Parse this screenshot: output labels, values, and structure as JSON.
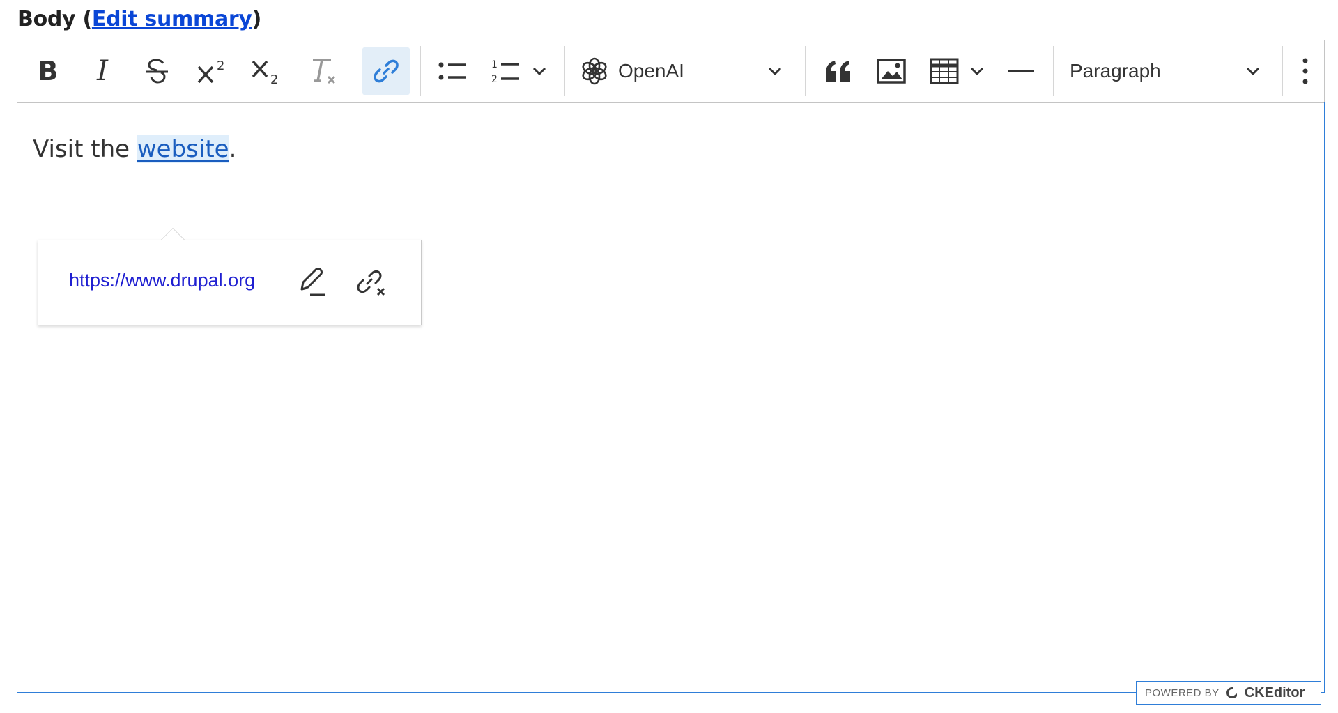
{
  "field": {
    "label_prefix": "Body (",
    "edit_summary_link": "Edit summary",
    "label_suffix": ")"
  },
  "toolbar": {
    "bold_label": "B",
    "italic_label": "I",
    "openai_label": "OpenAI",
    "paragraph_label": "Paragraph"
  },
  "content": {
    "text_before": "Visit the ",
    "link_text": "website",
    "text_after": "."
  },
  "link_balloon": {
    "url": "https://www.drupal.org"
  },
  "powered_by": {
    "prefix": "POWERED BY",
    "brand": "CKEditor"
  },
  "colors": {
    "accent": "#2f7ed8",
    "link": "#1a5dbf",
    "active_button_bg": "#e3eef8"
  }
}
